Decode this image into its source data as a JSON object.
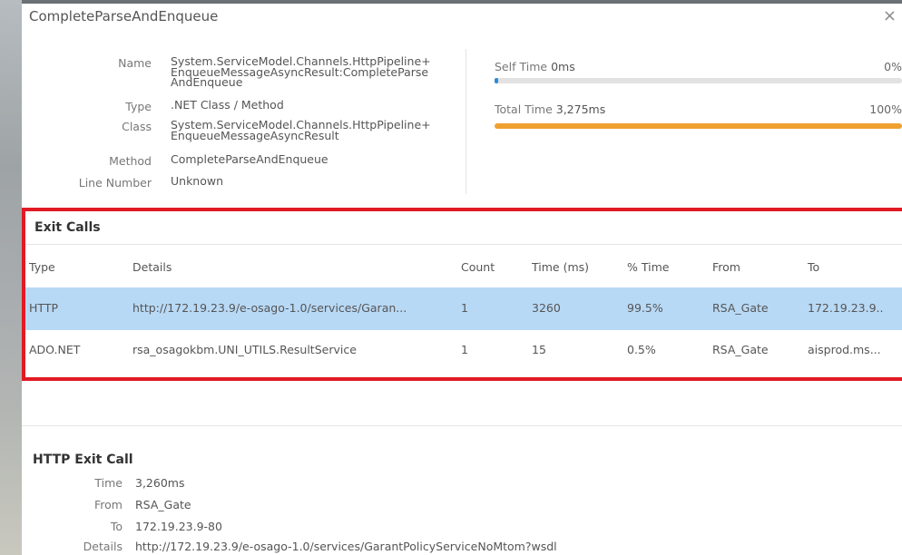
{
  "panel": {
    "title": "CompleteParseAndEnqueue",
    "close_glyph": "×"
  },
  "info": {
    "name_label": "Name",
    "name_value": "System.ServiceModel.Channels.HttpPipeline+ EnqueueMessageAsyncResult:CompleteParse AndEnqueue",
    "type_label": "Type",
    "type_value": ".NET Class / Method",
    "class_label": "Class",
    "class_value": "System.ServiceModel.Channels.HttpPipeline+ EnqueueMessageAsyncResult",
    "method_label": "Method",
    "method_value": "CompleteParseAndEnqueue",
    "line_label": "Line Number",
    "line_value": "Unknown"
  },
  "metrics": {
    "self_label": "Self Time",
    "self_value": "0ms",
    "self_pct": "0%",
    "self_fraction": 0.0,
    "total_label": "Total Time",
    "total_value": "3,275ms",
    "total_pct": "100%",
    "total_fraction": 1.0,
    "self_color": "#2b8ad6",
    "total_color": "#f0a030"
  },
  "exit_calls": {
    "title": "Exit Calls",
    "columns": [
      "Type",
      "Details",
      "Count",
      "Time (ms)",
      "% Time",
      "From",
      "To"
    ],
    "rows": [
      [
        "HTTP",
        "http://172.19.23.9/e-osago-1.0/services/Garan...",
        "1",
        "3260",
        "99.5%",
        "RSA_Gate",
        "172.19.23.9.."
      ],
      [
        "ADO.NET",
        "rsa_osagokbm.UNI_UTILS.ResultService",
        "1",
        "15",
        "0.5%",
        "RSA_Gate",
        "aisprod.ms..."
      ]
    ],
    "highlight_color": "#e01b24",
    "selected_row_color": "#b8d9f5"
  },
  "http_exit": {
    "title": "HTTP Exit Call",
    "time_label": "Time",
    "time_value": "3,260ms",
    "from_label": "From",
    "from_value": "RSA_Gate",
    "to_label": "To",
    "to_value": "172.19.23.9-80",
    "details_label": "Details",
    "details_value": "http://172.19.23.9/e-osago-1.0/services/GarantPolicyServiceNoMtom?wsdl"
  }
}
